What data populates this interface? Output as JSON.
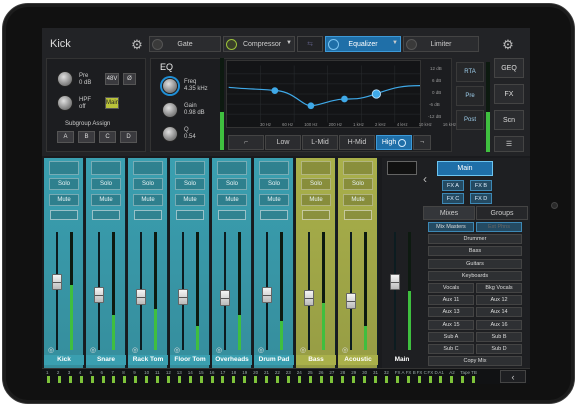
{
  "channel": {
    "name": "Kick"
  },
  "tabs": [
    {
      "label": "Gate",
      "power": "off"
    },
    {
      "label": "Compressor",
      "power": "on"
    },
    {
      "label": "Equalizer",
      "power": "on",
      "active": true
    },
    {
      "label": "Limiter",
      "power": "off"
    }
  ],
  "input": {
    "pre": {
      "label": "Pre",
      "value": "0 dB"
    },
    "hpf": {
      "label": "HPF",
      "value": "off"
    },
    "buttons": [
      "48V",
      "Ø",
      "Main"
    ],
    "subgroup_label": "Subgroup Assign",
    "subgroups": [
      "A",
      "B",
      "C",
      "D"
    ]
  },
  "eq": {
    "title": "EQ",
    "freq": {
      "label": "Freq",
      "value": "4.35 kHz"
    },
    "gain": {
      "label": "Gain",
      "value": "0.98 dB"
    },
    "q": {
      "label": "Q",
      "value": "0.54"
    },
    "db_labels": [
      "12 dB",
      "6 dB",
      "0 dB",
      "-6 dB",
      "-12 dB"
    ],
    "freq_labels": [
      "30 Hz",
      "60 Hz",
      "100 Hz",
      "200 Hz",
      "1 kHz",
      "2 kHz",
      "4 kHz",
      "10 kHz",
      "16 kHz"
    ],
    "bands": [
      "Low",
      "L-Mid",
      "H-Mid",
      "High"
    ],
    "active_band": "High"
  },
  "side": {
    "buttons": [
      "RTA",
      "Pre",
      "Post"
    ]
  },
  "right_nav": [
    "GEQ",
    "FX",
    "Scn"
  ],
  "strips": [
    {
      "name": "Kick",
      "color": "#3a9fb0",
      "fader": 0.62,
      "meter": 0.55
    },
    {
      "name": "Snare",
      "color": "#3a9fb0",
      "fader": 0.5,
      "meter": 0.3
    },
    {
      "name": "Rack Tom",
      "color": "#3a9fb0",
      "fader": 0.48,
      "meter": 0.35
    },
    {
      "name": "Floor Tom",
      "color": "#3a9fb0",
      "fader": 0.48,
      "meter": 0.2
    },
    {
      "name": "Overheads",
      "color": "#3a9fb0",
      "fader": 0.47,
      "meter": 0.3
    },
    {
      "name": "Drum Pad",
      "color": "#3a9fb0",
      "fader": 0.5,
      "meter": 0.25
    },
    {
      "name": "Bass",
      "color": "#a9b04a",
      "fader": 0.47,
      "meter": 0.4
    },
    {
      "name": "Acoustic",
      "color": "#a9b04a",
      "fader": 0.45,
      "meter": 0.2
    },
    {
      "name": "Main",
      "color": "#222326",
      "fader": 0.62,
      "meter": 0.5
    }
  ],
  "strip_buttons": {
    "solo": "Solo",
    "mute": "Mute"
  },
  "right_panel": {
    "main": "Main",
    "fx": [
      "FX A",
      "FX B",
      "FX C",
      "FX D"
    ],
    "tabs": [
      "Mixes",
      "Groups"
    ],
    "items": [
      [
        "Mix Masters",
        "Ext Phns"
      ],
      [
        "Drummer"
      ],
      [
        "Bass"
      ],
      [
        "Guitars"
      ],
      [
        "Keyboards"
      ],
      [
        "Vocals",
        "Bkg Vocals"
      ],
      [
        "Aux 11",
        "Aux 12"
      ],
      [
        "Aux 13",
        "Aux 14"
      ],
      [
        "Aux 15",
        "Aux 16"
      ],
      [
        "Sub A",
        "Sub B"
      ],
      [
        "Sub C",
        "Sub D"
      ],
      [
        "Copy Mix"
      ]
    ]
  },
  "bottom_numbers": [
    "1",
    "2",
    "3",
    "4",
    "5",
    "6",
    "7",
    "8",
    "9",
    "10",
    "11",
    "12",
    "13",
    "14",
    "15",
    "16",
    "17",
    "18",
    "19",
    "20",
    "21",
    "22",
    "23",
    "24",
    "25",
    "26",
    "27",
    "28",
    "29",
    "30",
    "31",
    "32",
    "FX A",
    "FX B",
    "FX C",
    "FX D",
    "A1",
    "A2",
    "Tape",
    "TB"
  ],
  "colors": {
    "accent": "#1f6fa8",
    "drums": "#3a9fb0",
    "melodic": "#a9b04a"
  }
}
